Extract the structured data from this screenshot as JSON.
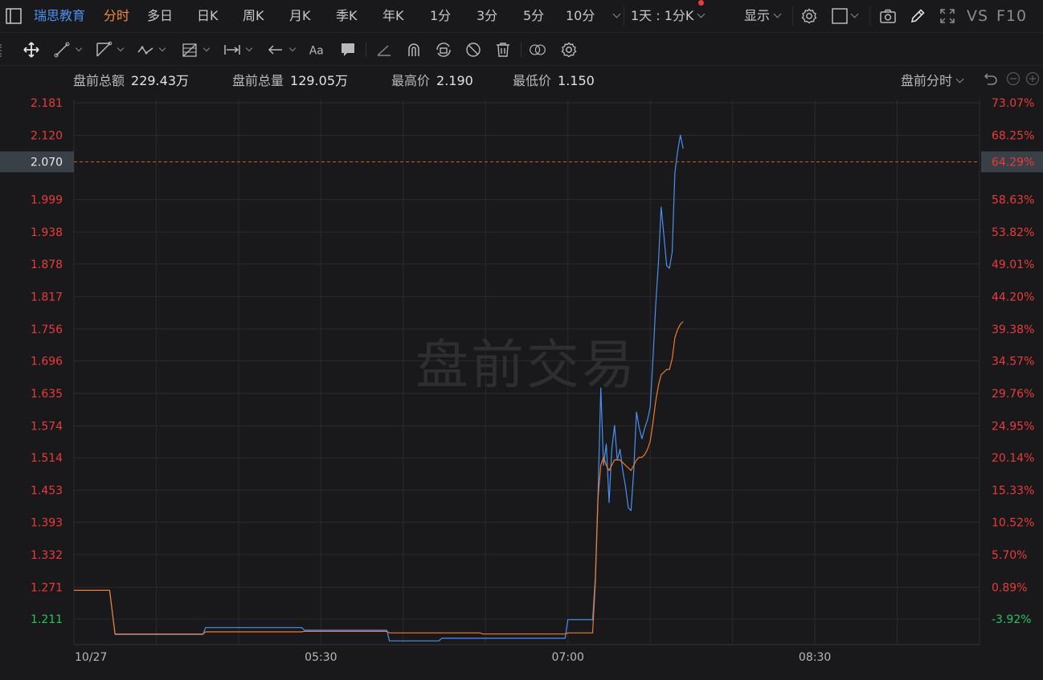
{
  "topbar": {
    "stock_name": "瑞思教育",
    "periods": [
      {
        "label": "分时",
        "active": true
      },
      {
        "label": "多日",
        "active": false
      },
      {
        "label": "日K",
        "active": false
      },
      {
        "label": "周K",
        "active": false
      },
      {
        "label": "月K",
        "active": false
      },
      {
        "label": "季K",
        "active": false
      },
      {
        "label": "年K",
        "active": false
      },
      {
        "label": "1分",
        "active": false
      },
      {
        "label": "3分",
        "active": false
      },
      {
        "label": "5分",
        "active": false
      },
      {
        "label": "10分",
        "active": false
      }
    ],
    "range_select": "1天 : 1分K",
    "display_label": "显示",
    "vs_label": "VS",
    "f10_label": "F10"
  },
  "stats": {
    "amount_label": "盘前总额",
    "amount_value": "229.43万",
    "volume_label": "盘前总量",
    "volume_value": "129.05万",
    "high_label": "最高价",
    "high_value": "2.190",
    "low_label": "最低价",
    "low_value": "1.150",
    "session_select": "盘前分时"
  },
  "colors": {
    "background": "#19191b",
    "grid": "#2a2a2d",
    "price_line": "#4b8ff0",
    "avg_line": "#f07a2a",
    "up": "#ea3b3b",
    "down": "#2fbf5f",
    "active_tab": "#f08a3c",
    "stock_name": "#4b8ff0",
    "current_price_bg": "#3a4048"
  },
  "chart_data": {
    "type": "line",
    "watermark": "盘前交易",
    "current_price": "2.070",
    "current_pct": "64.29%",
    "current_value": 2.07,
    "ylim": [
      1.181,
      2.181
    ],
    "y_ticks": [
      {
        "price": "2.181",
        "pct": "73.07%",
        "dir": "up"
      },
      {
        "price": "2.120",
        "pct": "68.25%",
        "dir": "up"
      },
      {
        "price": "1.999",
        "pct": "58.63%",
        "dir": "up"
      },
      {
        "price": "1.938",
        "pct": "53.82%",
        "dir": "up"
      },
      {
        "price": "1.878",
        "pct": "49.01%",
        "dir": "up"
      },
      {
        "price": "1.817",
        "pct": "44.20%",
        "dir": "up"
      },
      {
        "price": "1.756",
        "pct": "39.38%",
        "dir": "up"
      },
      {
        "price": "1.696",
        "pct": "34.57%",
        "dir": "up"
      },
      {
        "price": "1.635",
        "pct": "29.76%",
        "dir": "up"
      },
      {
        "price": "1.574",
        "pct": "24.95%",
        "dir": "up"
      },
      {
        "price": "1.514",
        "pct": "20.14%",
        "dir": "up"
      },
      {
        "price": "1.453",
        "pct": "15.33%",
        "dir": "up"
      },
      {
        "price": "1.393",
        "pct": "10.52%",
        "dir": "up"
      },
      {
        "price": "1.332",
        "pct": "5.70%",
        "dir": "up"
      },
      {
        "price": "1.271",
        "pct": "0.89%",
        "dir": "up"
      },
      {
        "price": "1.211",
        "pct": "-3.92%",
        "dir": "down"
      }
    ],
    "x_labels": [
      {
        "label": "10/27",
        "minute": 0
      },
      {
        "label": "05:30",
        "minute": 90
      },
      {
        "label": "07:00",
        "minute": 180
      },
      {
        "label": "08:30",
        "minute": 270
      }
    ],
    "x_range_minutes": [
      0,
      330
    ],
    "series": [
      {
        "id": "price",
        "points": [
          [
            0,
            1.265
          ],
          [
            13,
            1.265
          ],
          [
            15,
            1.182
          ],
          [
            47,
            1.182
          ],
          [
            48,
            1.195
          ],
          [
            83,
            1.195
          ],
          [
            84,
            1.19
          ],
          [
            114,
            1.19
          ],
          [
            115,
            1.17
          ],
          [
            133,
            1.17
          ],
          [
            134,
            1.175
          ],
          [
            179,
            1.175
          ],
          [
            180,
            1.21
          ],
          [
            189,
            1.21
          ],
          [
            190,
            1.29
          ],
          [
            191,
            1.45
          ],
          [
            192,
            1.645
          ],
          [
            193,
            1.5
          ],
          [
            194,
            1.54
          ],
          [
            195,
            1.43
          ],
          [
            196,
            1.53
          ],
          [
            197,
            1.575
          ],
          [
            198,
            1.51
          ],
          [
            199,
            1.53
          ],
          [
            200,
            1.49
          ],
          [
            201,
            1.46
          ],
          [
            202,
            1.42
          ],
          [
            203,
            1.415
          ],
          [
            204,
            1.49
          ],
          [
            205,
            1.6
          ],
          [
            206,
            1.57
          ],
          [
            207,
            1.55
          ],
          [
            208,
            1.57
          ],
          [
            209,
            1.585
          ],
          [
            210,
            1.61
          ],
          [
            211,
            1.7
          ],
          [
            212,
            1.8
          ],
          [
            213,
            1.88
          ],
          [
            214,
            1.985
          ],
          [
            215,
            1.93
          ],
          [
            216,
            1.875
          ],
          [
            217,
            1.87
          ],
          [
            218,
            1.9
          ],
          [
            219,
            2.05
          ],
          [
            220,
            2.09
          ],
          [
            221,
            2.12
          ],
          [
            222,
            2.095
          ]
        ]
      },
      {
        "id": "average",
        "points": [
          [
            0,
            1.265
          ],
          [
            13,
            1.265
          ],
          [
            15,
            1.183
          ],
          [
            47,
            1.183
          ],
          [
            48,
            1.187
          ],
          [
            83,
            1.187
          ],
          [
            84,
            1.188
          ],
          [
            114,
            1.188
          ],
          [
            115,
            1.185
          ],
          [
            148,
            1.185
          ],
          [
            149,
            1.183
          ],
          [
            179,
            1.183
          ],
          [
            180,
            1.185
          ],
          [
            189,
            1.185
          ],
          [
            190,
            1.28
          ],
          [
            191,
            1.44
          ],
          [
            192,
            1.5
          ],
          [
            193,
            1.515
          ],
          [
            194,
            1.5
          ],
          [
            195,
            1.49
          ],
          [
            196,
            1.5
          ],
          [
            197,
            1.51
          ],
          [
            198,
            1.51
          ],
          [
            199,
            1.51
          ],
          [
            200,
            1.505
          ],
          [
            201,
            1.5
          ],
          [
            202,
            1.495
          ],
          [
            203,
            1.49
          ],
          [
            204,
            1.5
          ],
          [
            205,
            1.51
          ],
          [
            206,
            1.515
          ],
          [
            207,
            1.515
          ],
          [
            208,
            1.52
          ],
          [
            209,
            1.53
          ],
          [
            210,
            1.545
          ],
          [
            211,
            1.58
          ],
          [
            212,
            1.62
          ],
          [
            213,
            1.65
          ],
          [
            214,
            1.67
          ],
          [
            215,
            1.675
          ],
          [
            216,
            1.68
          ],
          [
            217,
            1.68
          ],
          [
            218,
            1.7
          ],
          [
            219,
            1.74
          ],
          [
            220,
            1.755
          ],
          [
            221,
            1.765
          ],
          [
            222,
            1.77
          ]
        ]
      }
    ]
  }
}
